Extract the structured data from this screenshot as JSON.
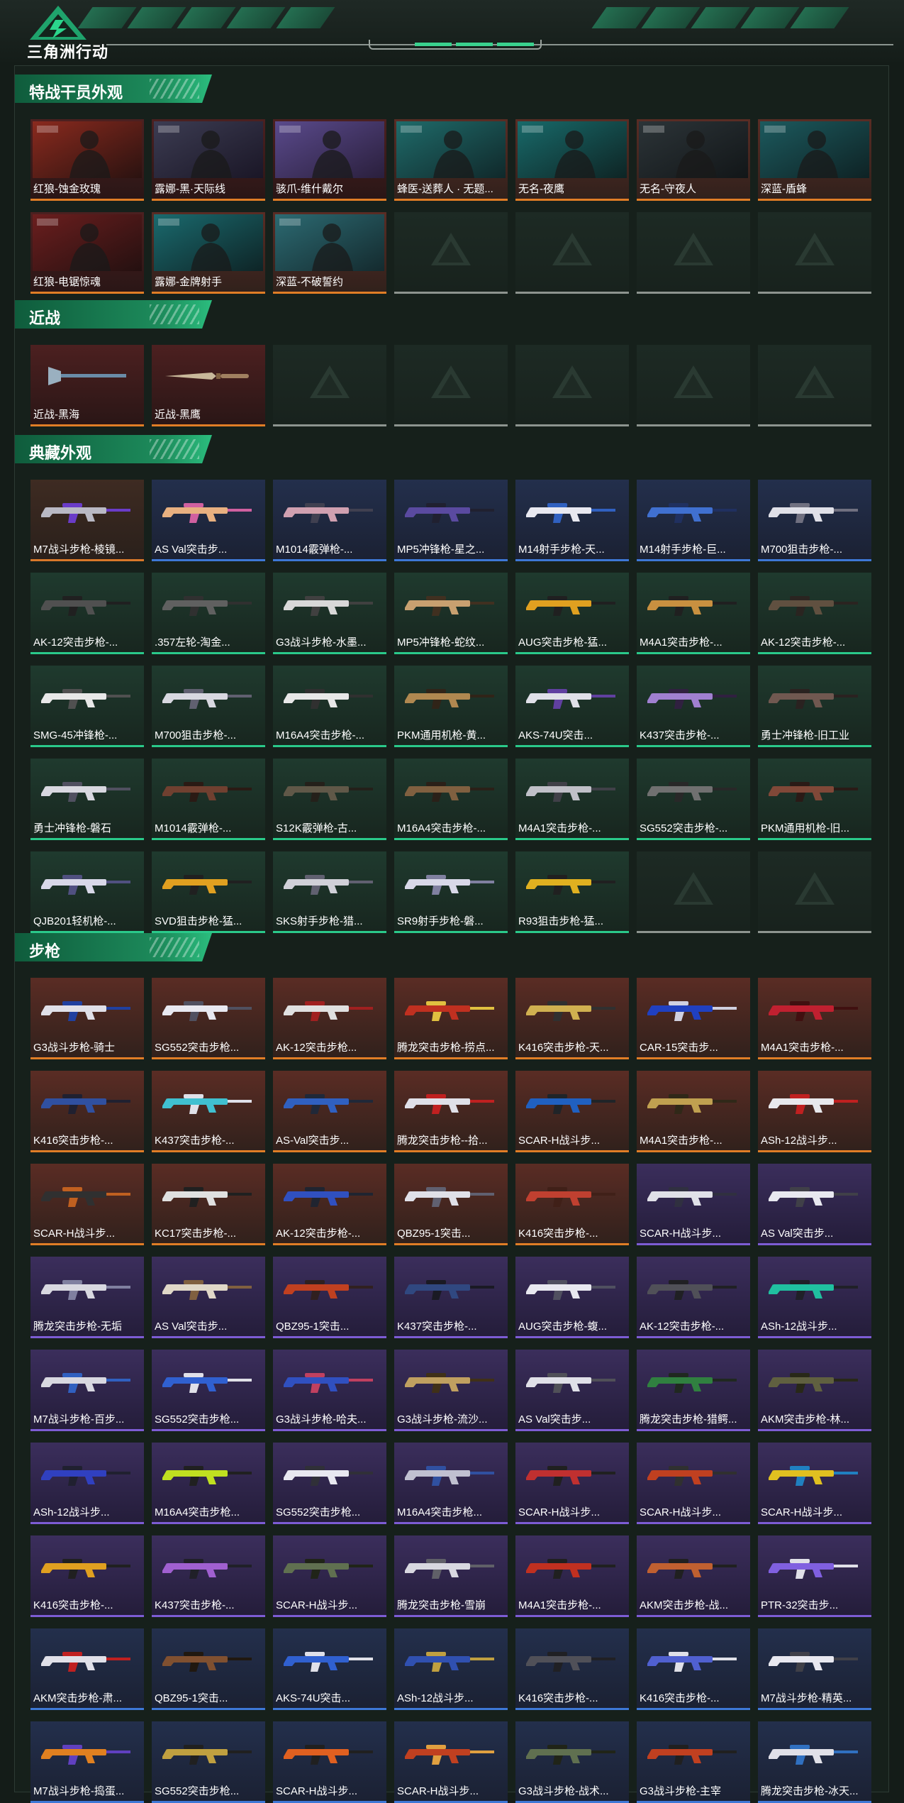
{
  "header": {
    "game_title": "三角洲行动"
  },
  "sections": [
    {
      "title": "特战干员外观",
      "items": [
        {
          "label": "红狼-蚀金玫瑰",
          "rarity": "red",
          "kind": "portrait",
          "c1": "#8a2a1e",
          "c2": "#2a1210"
        },
        {
          "label": "露娜-黑·天际线",
          "rarity": "red",
          "kind": "portrait",
          "c1": "#3c3c52",
          "c2": "#1a1626"
        },
        {
          "label": "骇爪-维什戴尔",
          "rarity": "red",
          "kind": "portrait",
          "c1": "#5a4a8c",
          "c2": "#2a1f3c"
        },
        {
          "label": "蜂医-送葬人 · 无题...",
          "rarity": "orange",
          "kind": "portrait",
          "c1": "#1f6b6a",
          "c2": "#10282a"
        },
        {
          "label": "无名-夜鹰",
          "rarity": "orange",
          "kind": "portrait",
          "c1": "#186a6a",
          "c2": "#0e2424"
        },
        {
          "label": "无名-守夜人",
          "rarity": "orange",
          "kind": "portrait",
          "c1": "#2c3438",
          "c2": "#121618"
        },
        {
          "label": "深蓝-盾蜂",
          "rarity": "orange",
          "kind": "portrait",
          "c1": "#1c5a5e",
          "c2": "#0e2224"
        },
        {
          "label": "红狼-电锯惊魂",
          "rarity": "red",
          "kind": "portrait",
          "c1": "#6b1e1e",
          "c2": "#241010"
        },
        {
          "label": "露娜-金牌射手",
          "rarity": "orange",
          "kind": "portrait",
          "c1": "#1a6a6e",
          "c2": "#0e2426"
        },
        {
          "label": "深蓝-不破誓约",
          "rarity": "orange",
          "kind": "portrait",
          "c1": "#2c6a72",
          "c2": "#142a2e"
        },
        {
          "empty": true
        },
        {
          "empty": true
        },
        {
          "empty": true
        },
        {
          "empty": true
        }
      ]
    },
    {
      "title": "近战",
      "items": [
        {
          "label": "近战-黑海",
          "rarity": "red",
          "kind": "axe",
          "c1": "#6a8ca8",
          "c2": "#1a1a22"
        },
        {
          "label": "近战-黑鹰",
          "rarity": "red",
          "kind": "knife",
          "c1": "#c8b89a",
          "c2": "#141416"
        },
        {
          "empty": true
        },
        {
          "empty": true
        },
        {
          "empty": true
        },
        {
          "empty": true
        },
        {
          "empty": true
        }
      ]
    },
    {
      "title": "典藏外观",
      "items": [
        {
          "label": "M7战斗步枪-棱镜...",
          "rarity": "brown",
          "kind": "gun",
          "c1": "#b9b9c4",
          "c2": "#6a3cc8"
        },
        {
          "label": "AS Val突击步...",
          "rarity": "blue",
          "kind": "gun",
          "c1": "#e8b080",
          "c2": "#d060a0"
        },
        {
          "label": "M1014霰弹枪-...",
          "rarity": "blue",
          "kind": "gun",
          "c1": "#d0a0b0",
          "c2": "#404050"
        },
        {
          "label": "MP5冲锋枪-星之...",
          "rarity": "blue",
          "kind": "gun",
          "c1": "#5a4aa0",
          "c2": "#202030"
        },
        {
          "label": "M14射手步枪-天...",
          "rarity": "blue",
          "kind": "gun",
          "c1": "#e8e8f0",
          "c2": "#3060c0"
        },
        {
          "label": "M14射手步枪-巨...",
          "rarity": "blue",
          "kind": "gun",
          "c1": "#4070d0",
          "c2": "#203060"
        },
        {
          "label": "M700狙击步枪-...",
          "rarity": "blue",
          "kind": "gun",
          "c1": "#e0e0e8",
          "c2": "#707080"
        },
        {
          "label": "AK-12突击步枪-...",
          "rarity": "green",
          "kind": "gun",
          "c1": "#505050",
          "c2": "#202020"
        },
        {
          "label": ".357左轮-淘金...",
          "rarity": "green",
          "kind": "gun",
          "c1": "#606060",
          "c2": "#303030"
        },
        {
          "label": "G3战斗步枪-水墨...",
          "rarity": "green",
          "kind": "gun",
          "c1": "#d8d8d8",
          "c2": "#404040"
        },
        {
          "label": "MP5冲锋枪-蛇纹...",
          "rarity": "green",
          "kind": "gun",
          "c1": "#c8a070",
          "c2": "#403020"
        },
        {
          "label": "AUG突击步枪-猛...",
          "rarity": "green",
          "kind": "gun",
          "c1": "#e0a020",
          "c2": "#202020"
        },
        {
          "label": "M4A1突击步枪-...",
          "rarity": "green",
          "kind": "gun",
          "c1": "#c89040",
          "c2": "#202020"
        },
        {
          "label": "AK-12突击步枪-...",
          "rarity": "green",
          "kind": "gun",
          "c1": "#605040",
          "c2": "#2a2420"
        },
        {
          "label": "SMG-45冲锋枪-...",
          "rarity": "green",
          "kind": "gun",
          "c1": "#e8e8e8",
          "c2": "#505050"
        },
        {
          "label": "M700狙击步枪-...",
          "rarity": "green",
          "kind": "gun",
          "c1": "#d8d8e0",
          "c2": "#606070"
        },
        {
          "label": "M16A4突击步枪-...",
          "rarity": "green",
          "kind": "gun",
          "c1": "#e8e8e8",
          "c2": "#303030"
        },
        {
          "label": "PKM通用机枪-黄...",
          "rarity": "green",
          "kind": "gun",
          "c1": "#b08850",
          "c2": "#302418"
        },
        {
          "label": "AKS-74U突击...",
          "rarity": "green",
          "kind": "gun",
          "c1": "#e0e0e8",
          "c2": "#6040a0"
        },
        {
          "label": "K437突击步枪-...",
          "rarity": "green",
          "kind": "gun",
          "c1": "#a080d0",
          "c2": "#302040"
        },
        {
          "label": "勇士冲锋枪-旧工业",
          "rarity": "green",
          "kind": "gun",
          "c1": "#705850",
          "c2": "#2a2220"
        },
        {
          "label": "勇士冲锋枪-磐石",
          "rarity": "green",
          "kind": "gun",
          "c1": "#d8d8e0",
          "c2": "#505060"
        },
        {
          "label": "M1014霰弹枪-...",
          "rarity": "green",
          "kind": "gun",
          "c1": "#704030",
          "c2": "#2a1a14"
        },
        {
          "label": "S12K霰弹枪-古...",
          "rarity": "green",
          "kind": "gun",
          "c1": "#605848",
          "c2": "#24201a"
        },
        {
          "label": "M16A4突击步枪-...",
          "rarity": "green",
          "kind": "gun",
          "c1": "#806040",
          "c2": "#2a2018"
        },
        {
          "label": "M4A1突击步枪-...",
          "rarity": "green",
          "kind": "gun",
          "c1": "#c0c0c8",
          "c2": "#404048"
        },
        {
          "label": "SG552突击步枪-...",
          "rarity": "green",
          "kind": "gun",
          "c1": "#707070",
          "c2": "#282828"
        },
        {
          "label": "PKM通用机枪-旧...",
          "rarity": "green",
          "kind": "gun",
          "c1": "#804838",
          "c2": "#2a1a16"
        },
        {
          "label": "QJB201轻机枪-...",
          "rarity": "green",
          "kind": "gun",
          "c1": "#d8d8e8",
          "c2": "#505080"
        },
        {
          "label": "SVD狙击步枪-猛...",
          "rarity": "green",
          "kind": "gun",
          "c1": "#e0a020",
          "c2": "#202020"
        },
        {
          "label": "SKS射手步枪-猎...",
          "rarity": "green",
          "kind": "gun",
          "c1": "#d0d0d8",
          "c2": "#606070"
        },
        {
          "label": "SR9射手步枪-磐...",
          "rarity": "green",
          "kind": "gun",
          "c1": "#d8d8e8",
          "c2": "#8080a0"
        },
        {
          "label": "R93狙击步枪-猛...",
          "rarity": "green",
          "kind": "gun",
          "c1": "#e0b020",
          "c2": "#202020"
        },
        {
          "empty": true
        },
        {
          "empty": true
        }
      ]
    },
    {
      "title": "步枪",
      "items": [
        {
          "label": "G3战斗步枪-骑士",
          "rarity": "orange",
          "kind": "gun",
          "c1": "#e0e0e8",
          "c2": "#2040a0"
        },
        {
          "label": "SG552突击步枪...",
          "rarity": "orange",
          "kind": "gun",
          "c1": "#e8e8f0",
          "c2": "#505060"
        },
        {
          "label": "AK-12突击步枪...",
          "rarity": "orange",
          "kind": "gun",
          "c1": "#e0e0e0",
          "c2": "#a02020"
        },
        {
          "label": "腾龙突击步枪-捞点...",
          "rarity": "orange",
          "kind": "gun",
          "c1": "#c03020",
          "c2": "#e0c040"
        },
        {
          "label": "K416突击步枪-天...",
          "rarity": "orange",
          "kind": "gun",
          "c1": "#d0b050",
          "c2": "#303030"
        },
        {
          "label": "CAR-15突击步...",
          "rarity": "orange",
          "kind": "gun",
          "c1": "#2040c0",
          "c2": "#d0d0e0"
        },
        {
          "label": "M4A1突击步枪-...",
          "rarity": "orange",
          "kind": "gun",
          "c1": "#c02030",
          "c2": "#401010"
        },
        {
          "label": "K416突击步枪-...",
          "rarity": "orange",
          "kind": "gun",
          "c1": "#3050a0",
          "c2": "#202030"
        },
        {
          "label": "K437突击步枪-...",
          "rarity": "orange",
          "kind": "gun",
          "c1": "#40c0d0",
          "c2": "#e0e0e8"
        },
        {
          "label": "AS-Val突击步...",
          "rarity": "orange",
          "kind": "gun",
          "c1": "#3060c0",
          "c2": "#202838"
        },
        {
          "label": "腾龙突击步枪--拾...",
          "rarity": "orange",
          "kind": "gun",
          "c1": "#e0e0e8",
          "c2": "#c02020"
        },
        {
          "label": "SCAR-H战斗步...",
          "rarity": "orange",
          "kind": "gun",
          "c1": "#2060c0",
          "c2": "#202428"
        },
        {
          "label": "M4A1突击步枪-...",
          "rarity": "orange",
          "kind": "gun",
          "c1": "#c0a050",
          "c2": "#302818"
        },
        {
          "label": "ASh-12战斗步...",
          "rarity": "orange",
          "kind": "gun",
          "c1": "#e8e8ec",
          "c2": "#c02020"
        },
        {
          "label": "SCAR-H战斗步...",
          "rarity": "orange",
          "kind": "gun",
          "c1": "#303030",
          "c2": "#c06020"
        },
        {
          "label": "KC17突击步枪-...",
          "rarity": "orange",
          "kind": "gun",
          "c1": "#e0e0e0",
          "c2": "#202020"
        },
        {
          "label": "AK-12突击步枪-...",
          "rarity": "orange",
          "kind": "gun",
          "c1": "#3050c0",
          "c2": "#202430"
        },
        {
          "label": "QBZ95-1突击...",
          "rarity": "orange",
          "kind": "gun",
          "c1": "#e0e0e8",
          "c2": "#606070"
        },
        {
          "label": "K416突击步枪-...",
          "rarity": "orange",
          "kind": "gun",
          "c1": "#c04030",
          "c2": "#402018"
        },
        {
          "label": "SCAR-H战斗步...",
          "rarity": "purple",
          "kind": "gun",
          "c1": "#e0e0e8",
          "c2": "#303040"
        },
        {
          "label": "AS Val突击步...",
          "rarity": "purple",
          "kind": "gun",
          "c1": "#e8e8f0",
          "c2": "#404048"
        },
        {
          "label": "腾龙突击步枪-无垢",
          "rarity": "purple",
          "kind": "gun",
          "c1": "#d8d8e0",
          "c2": "#8080a0"
        },
        {
          "label": "AS Val突击步...",
          "rarity": "purple",
          "kind": "gun",
          "c1": "#e0d8c8",
          "c2": "#806040"
        },
        {
          "label": "QBZ95-1突击...",
          "rarity": "purple",
          "kind": "gun",
          "c1": "#c04020",
          "c2": "#302020"
        },
        {
          "label": "K437突击步枪-...",
          "rarity": "purple",
          "kind": "gun",
          "c1": "#304880",
          "c2": "#1a1a24"
        },
        {
          "label": "AUG突击步枪-蝮...",
          "rarity": "purple",
          "kind": "gun",
          "c1": "#e8e8f0",
          "c2": "#505060"
        },
        {
          "label": "AK-12突击步枪-...",
          "rarity": "purple",
          "kind": "gun",
          "c1": "#505058",
          "c2": "#202024"
        },
        {
          "label": "ASh-12战斗步...",
          "rarity": "purple",
          "kind": "gun",
          "c1": "#20c0a0",
          "c2": "#202028"
        },
        {
          "label": "M7战斗步枪-百步...",
          "rarity": "purple",
          "kind": "gun",
          "c1": "#d8d8e0",
          "c2": "#3060c0"
        },
        {
          "label": "SG552突击步枪...",
          "rarity": "purple",
          "kind": "gun",
          "c1": "#3060d0",
          "c2": "#e0e0e8"
        },
        {
          "label": "G3战斗步枪-哈夫...",
          "rarity": "purple",
          "kind": "gun",
          "c1": "#3050c0",
          "c2": "#c04060"
        },
        {
          "label": "G3战斗步枪-流沙...",
          "rarity": "purple",
          "kind": "gun",
          "c1": "#c0a060",
          "c2": "#403018"
        },
        {
          "label": "AS Val突击步...",
          "rarity": "purple",
          "kind": "gun",
          "c1": "#e0e0e8",
          "c2": "#505058"
        },
        {
          "label": "腾龙突击步枪-猎鳄...",
          "rarity": "purple",
          "kind": "gun",
          "c1": "#308040",
          "c2": "#202820"
        },
        {
          "label": "AKM突击步枪-林...",
          "rarity": "purple",
          "kind": "gun",
          "c1": "#606040",
          "c2": "#282818"
        },
        {
          "label": "ASh-12战斗步...",
          "rarity": "purple",
          "kind": "gun",
          "c1": "#3040c0",
          "c2": "#202030"
        },
        {
          "label": "M16A4突击步枪...",
          "rarity": "purple",
          "kind": "gun",
          "c1": "#c0e020",
          "c2": "#202020"
        },
        {
          "label": "SG552突击步枪...",
          "rarity": "purple",
          "kind": "gun",
          "c1": "#e8e8f0",
          "c2": "#303038"
        },
        {
          "label": "M16A4突击步枪...",
          "rarity": "purple",
          "kind": "gun",
          "c1": "#c0c0d0",
          "c2": "#3050a0"
        },
        {
          "label": "SCAR-H战斗步...",
          "rarity": "purple",
          "kind": "gun",
          "c1": "#c03030",
          "c2": "#202020"
        },
        {
          "label": "SCAR-H战斗步...",
          "rarity": "purple",
          "kind": "gun",
          "c1": "#c04020",
          "c2": "#303030"
        },
        {
          "label": "SCAR-H战斗步...",
          "rarity": "purple",
          "kind": "gun",
          "c1": "#e0c020",
          "c2": "#2080c0"
        },
        {
          "label": "K416突击步枪-...",
          "rarity": "purple",
          "kind": "gun",
          "c1": "#e0a020",
          "c2": "#202020"
        },
        {
          "label": "K437突击步枪-...",
          "rarity": "purple",
          "kind": "gun",
          "c1": "#a060d0",
          "c2": "#202028"
        },
        {
          "label": "SCAR-H战斗步...",
          "rarity": "purple",
          "kind": "gun",
          "c1": "#607050",
          "c2": "#202418"
        },
        {
          "label": "腾龙突击步枪-雪崩",
          "rarity": "purple",
          "kind": "gun",
          "c1": "#d8d8e0",
          "c2": "#606068"
        },
        {
          "label": "M4A1突击步枪-...",
          "rarity": "purple",
          "kind": "gun",
          "c1": "#c03020",
          "c2": "#202020"
        },
        {
          "label": "AKM突击步枪-战...",
          "rarity": "purple",
          "kind": "gun",
          "c1": "#c06030",
          "c2": "#202020"
        },
        {
          "label": "PTR-32突击步...",
          "rarity": "purple",
          "kind": "gun",
          "c1": "#8060e0",
          "c2": "#e0e0e8"
        },
        {
          "label": "AKM突击步枪-肃...",
          "rarity": "blue",
          "kind": "gun",
          "c1": "#e0e0e8",
          "c2": "#c02020"
        },
        {
          "label": "QBZ95-1突击...",
          "rarity": "blue",
          "kind": "gun",
          "c1": "#805030",
          "c2": "#201810"
        },
        {
          "label": "AKS-74U突击...",
          "rarity": "blue",
          "kind": "gun",
          "c1": "#3060d0",
          "c2": "#e0e0e8"
        },
        {
          "label": "ASh-12战斗步...",
          "rarity": "blue",
          "kind": "gun",
          "c1": "#3050b0",
          "c2": "#c0a040"
        },
        {
          "label": "K416突击步枪-...",
          "rarity": "blue",
          "kind": "gun",
          "c1": "#505058",
          "c2": "#202024"
        },
        {
          "label": "K416突击步枪-...",
          "rarity": "blue",
          "kind": "gun",
          "c1": "#5060d0",
          "c2": "#e0e0e8"
        },
        {
          "label": "M7战斗步枪-精英...",
          "rarity": "blue",
          "kind": "gun",
          "c1": "#e8e8f0",
          "c2": "#404048"
        },
        {
          "label": "M7战斗步枪-捣蛋...",
          "rarity": "blue",
          "kind": "gun",
          "c1": "#e08020",
          "c2": "#6040c0"
        },
        {
          "label": "SG552突击步枪...",
          "rarity": "blue",
          "kind": "gun",
          "c1": "#c0a040",
          "c2": "#202020"
        },
        {
          "label": "SCAR-H战斗步...",
          "rarity": "blue",
          "kind": "gun",
          "c1": "#e06020",
          "c2": "#202020"
        },
        {
          "label": "SCAR-H战斗步...",
          "rarity": "blue",
          "kind": "gun",
          "c1": "#c04020",
          "c2": "#e0a040"
        },
        {
          "label": "G3战斗步枪-战术...",
          "rarity": "blue",
          "kind": "gun",
          "c1": "#607050",
          "c2": "#202418"
        },
        {
          "label": "G3战斗步枪-主宰",
          "rarity": "blue",
          "kind": "gun",
          "c1": "#c04020",
          "c2": "#202020"
        },
        {
          "label": "腾龙突击步枪-冰天...",
          "rarity": "blue",
          "kind": "gun",
          "c1": "#e0e0e8",
          "c2": "#3070c0"
        }
      ]
    }
  ],
  "colors": {
    "accent": "#2bbd7e",
    "orange": "#e07d26",
    "purple": "#7d5cd4",
    "blue": "#3e78d6",
    "green": "#2ac98a",
    "empty": "#8d948f"
  }
}
